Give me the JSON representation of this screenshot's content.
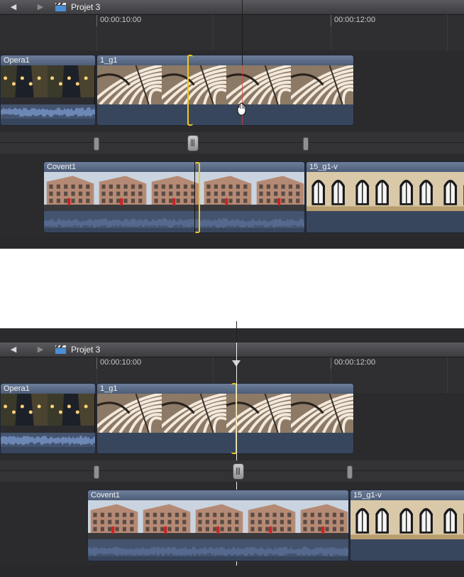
{
  "panels": [
    {
      "id": "before",
      "project_title": "Projet 3",
      "timecodes": [
        "00:00:10:00",
        "00:00:12:00"
      ],
      "primary_clips": [
        {
          "name": "Opera1",
          "kind": "night-street"
        },
        {
          "name": "1_g1",
          "kind": "stairs"
        }
      ],
      "connected_clips": [
        {
          "name": "Covent1",
          "kind": "building"
        },
        {
          "name": "15_g1-v",
          "kind": "arches"
        }
      ],
      "pointer": "hand-grab"
    },
    {
      "id": "after",
      "project_title": "Projet 3",
      "timecodes": [
        "00:00:10:00",
        "00:00:12:00"
      ],
      "primary_clips": [
        {
          "name": "Opera1",
          "kind": "night-street"
        },
        {
          "name": "1_g1",
          "kind": "stairs"
        }
      ],
      "connected_clips": [
        {
          "name": "Covent1",
          "kind": "building"
        },
        {
          "name": "15_g1-v",
          "kind": "arches"
        }
      ],
      "pointer": "none"
    }
  ],
  "colors": {
    "selection": "#f2c81e",
    "clip": "#44546f",
    "clip_header": "#6d7e9a",
    "timeline_bg": "#2b2b2d"
  },
  "icons": [
    "back-arrow-icon",
    "forward-arrow-icon",
    "clapperboard-icon",
    "hand-grab-icon",
    "playhead-icon"
  ]
}
